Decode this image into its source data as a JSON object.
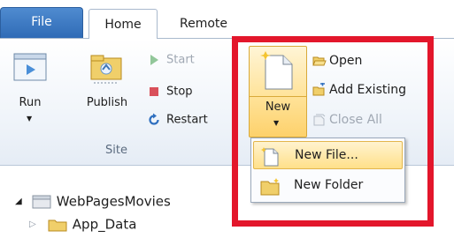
{
  "tabs": {
    "file": "File",
    "home": "Home",
    "remote": "Remote"
  },
  "site_group": {
    "label": "Site",
    "run": "Run",
    "publish": "Publish",
    "start": "Start",
    "stop": "Stop",
    "restart": "Restart"
  },
  "files_group": {
    "new": "New",
    "open": "Open",
    "add_existing": "Add Existing",
    "close_all": "Close All"
  },
  "new_menu": {
    "new_file": "New File...",
    "new_folder": "New Folder"
  },
  "tree": {
    "root": "WebPagesMovies",
    "child": "App_Data"
  },
  "colors": {
    "file_tab": "#3a78c2",
    "highlight": "#e3162b",
    "hover": "#ffe08a"
  }
}
